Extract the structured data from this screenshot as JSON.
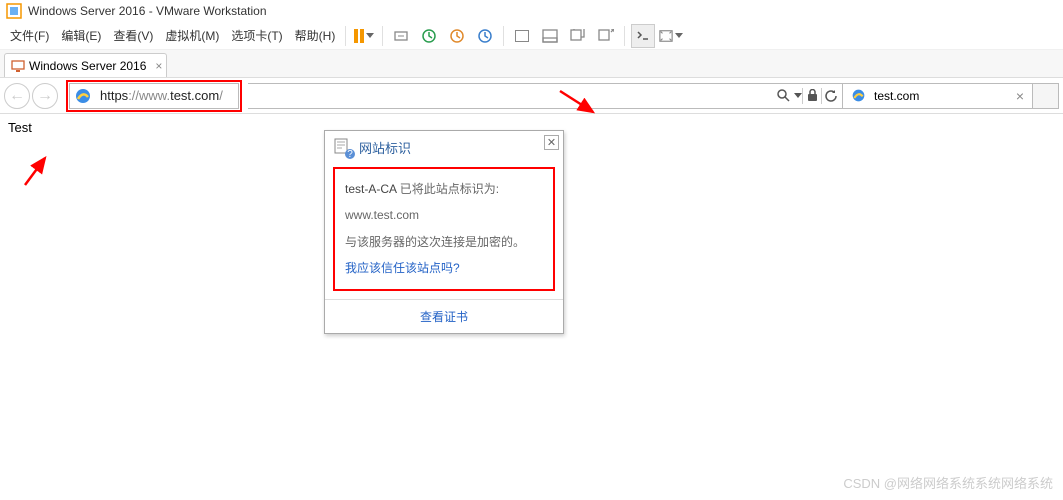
{
  "vmware": {
    "title": "Windows Server 2016 - VMware Workstation",
    "tab_label": "Windows Server 2016"
  },
  "menu": {
    "file": "文件(F)",
    "edit": "编辑(E)",
    "view": "查看(V)",
    "vm": "虚拟机(M)",
    "tabs": "选项卡(T)",
    "help": "帮助(H)"
  },
  "browser": {
    "url_scheme": "https",
    "url_sep": "://",
    "url_sub": "www.",
    "url_host": "test.com",
    "url_trail": "/",
    "tab_title": "test.com",
    "page_content": "Test"
  },
  "popup": {
    "title": "网站标识",
    "ca_name": "test-A-CA",
    "ca_identified_as": " 已将此站点标识为:",
    "domain": "www.test.com",
    "encrypted_msg": "与该服务器的这次连接是加密的。",
    "trust_link": "我应该信任该站点吗?",
    "view_cert": "查看证书"
  },
  "watermark": "CSDN @网络网络系统系统网络系统"
}
